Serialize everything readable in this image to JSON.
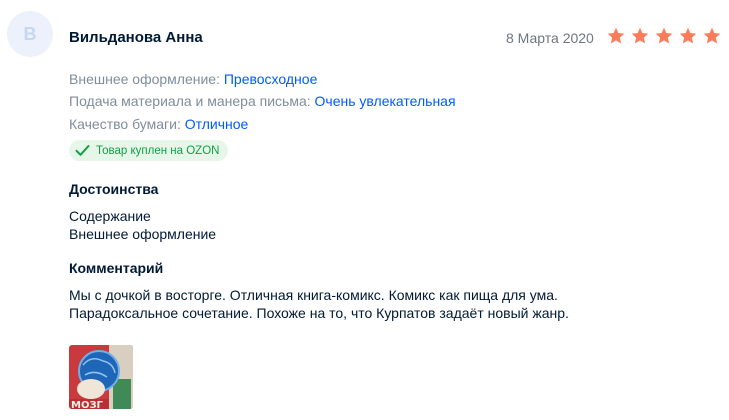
{
  "review": {
    "avatar_letter": "В",
    "author": "Вильданова Анна",
    "date": "8 Марта 2020",
    "rating": 5,
    "rating_max": 5,
    "star_color": "#f97d5b",
    "params": [
      {
        "label": "Внешнее оформление:",
        "value": "Превосходное"
      },
      {
        "label": "Подача материала и манера письма:",
        "value": "Очень увлекательная"
      },
      {
        "label": "Качество бумаги:",
        "value": "Отличное"
      }
    ],
    "badge": "Товар куплен на OZON",
    "advantages_title": "Достоинства",
    "advantages": [
      "Содержание",
      "Внешнее оформление"
    ],
    "comment_title": "Комментарий",
    "comment": "Мы с дочкой в восторге. Отличная книга-комикс. Комикс как пища для ума. Парадоксальное сочетание. Похоже на то, что Курпатов задаёт новый жанр.",
    "photo_caption": "МОЗГ"
  }
}
